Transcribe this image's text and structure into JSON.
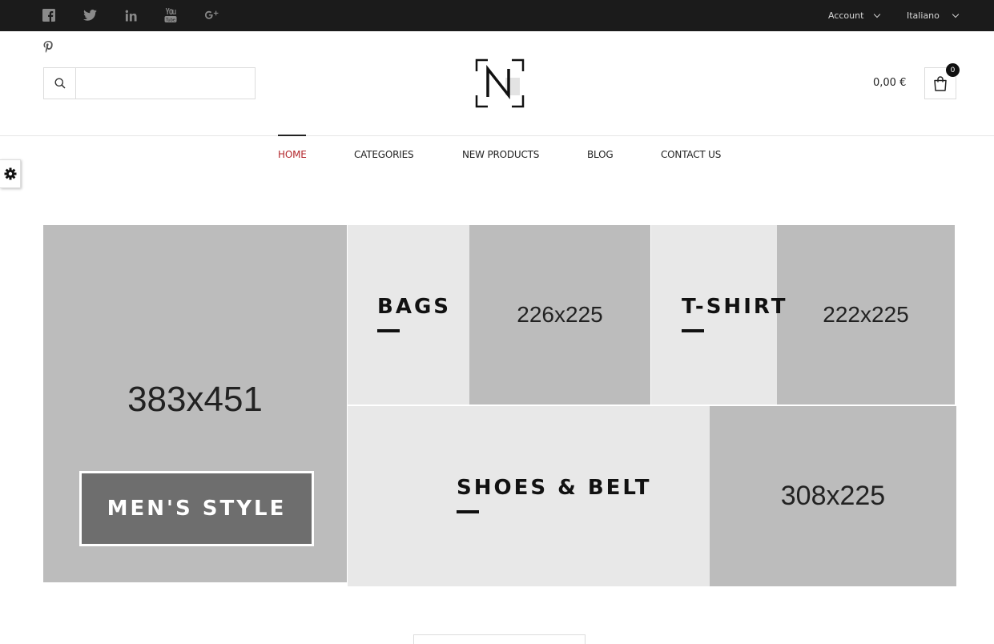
{
  "topbar": {
    "social": [
      {
        "name": "facebook"
      },
      {
        "name": "twitter"
      },
      {
        "name": "linkedin"
      },
      {
        "name": "youtube"
      },
      {
        "name": "google-plus"
      }
    ],
    "account_label": "Account",
    "language_label": "Italiano"
  },
  "search": {
    "placeholder": "",
    "value": ""
  },
  "cart": {
    "total": "0,00 €",
    "count": "0"
  },
  "nav": {
    "items": [
      {
        "label": "HOME",
        "active": true
      },
      {
        "label": "CATEGORIES",
        "active": false
      },
      {
        "label": "NEW PRODUCTS",
        "active": false
      },
      {
        "label": "BLOG",
        "active": false
      },
      {
        "label": "CONTACT US",
        "active": false
      }
    ]
  },
  "banners": {
    "mens": {
      "placeholder": "383x451",
      "button": "MEN'S STYLE"
    },
    "bags": {
      "title": "BAGS",
      "placeholder": "226x225"
    },
    "tshirt": {
      "title": "T-SHIRT",
      "placeholder": "222x225"
    },
    "shoes": {
      "title": "SHOES & BELT",
      "placeholder": "308x225"
    }
  },
  "colors": {
    "topbar": "#1b1b1b",
    "nav_active": "#b3272c",
    "placeholder": "#bcbcbc",
    "light_tile": "#e8e8e8"
  }
}
